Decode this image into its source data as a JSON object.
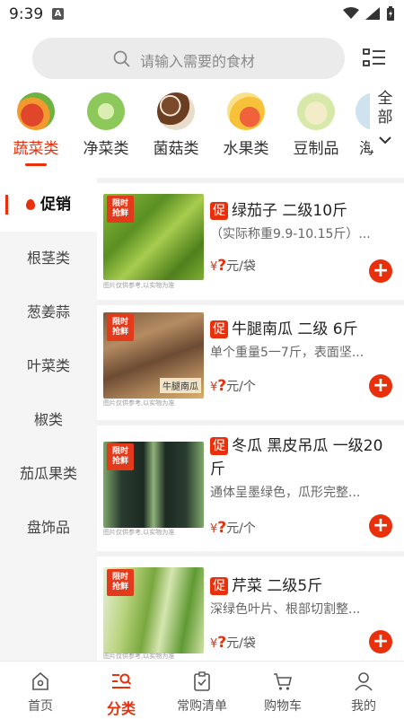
{
  "status_bar": {
    "time": "9:39"
  },
  "search": {
    "placeholder": "请输入需要的食材"
  },
  "categories": [
    {
      "label": "蔬菜类",
      "icon": "vegetables-icon",
      "active": true
    },
    {
      "label": "净菜类",
      "icon": "cabbage-icon"
    },
    {
      "label": "菌菇类",
      "icon": "mushroom-icon"
    },
    {
      "label": "水果类",
      "icon": "fruit-icon"
    },
    {
      "label": "豆制品",
      "icon": "bean-sprout-icon"
    },
    {
      "label": "海",
      "icon": "seafood-icon"
    }
  ],
  "all_button": {
    "line1": "全",
    "line2": "部"
  },
  "sidebar": {
    "items": [
      {
        "label": "促销",
        "active": true
      },
      {
        "label": "根茎类"
      },
      {
        "label": "葱姜蒜"
      },
      {
        "label": "叶菜类"
      },
      {
        "label": "椒类"
      },
      {
        "label": "茄瓜果类"
      },
      {
        "label": "盘饰品"
      }
    ]
  },
  "products": [
    {
      "tag": "促",
      "title": "绿茄子 二级10斤",
      "desc": "（实际称重9.9-10.15斤）...",
      "price_symbol": "¥",
      "price": "?",
      "unit": "元/袋",
      "badge": "限时抢鲜",
      "note": "图片仅供参考,以实物为准"
    },
    {
      "tag": "促",
      "title": "牛腿南瓜  二级 6斤",
      "desc": "单个重量5一7斤，表面坚...",
      "price_symbol": "¥",
      "price": "?",
      "unit": "元/个",
      "badge": "限时抢鲜",
      "note": "图片仅供参考,以实物为准",
      "photo_label": "牛腿南瓜"
    },
    {
      "tag": "促",
      "title": "冬瓜 黑皮吊瓜 一级20斤",
      "desc": "通体呈墨绿色，瓜形完整...",
      "price_symbol": "¥",
      "price": "?",
      "unit": "元/个",
      "badge": "限时抢鲜",
      "note": "图片仅供参考,以实物为准"
    },
    {
      "tag": "促",
      "title": "芹菜 二级5斤",
      "desc": "深绿色叶片、根部切割整...",
      "price_symbol": "¥",
      "price": "?",
      "unit": "元/袋",
      "badge": "限时抢鲜",
      "note": "图片仅供参考,以实物为准"
    }
  ],
  "tabbar": [
    {
      "label": "首页",
      "icon": "home-icon"
    },
    {
      "label": "分类",
      "icon": "category-icon",
      "active": true
    },
    {
      "label": "常购清单",
      "icon": "clipboard-check-icon"
    },
    {
      "label": "购物车",
      "icon": "cart-icon"
    },
    {
      "label": "我的",
      "icon": "user-icon"
    }
  ],
  "colors": {
    "accent": "#e8300d",
    "search_bg": "#ebebeb",
    "sidebar_bg": "#f5f5f5"
  }
}
